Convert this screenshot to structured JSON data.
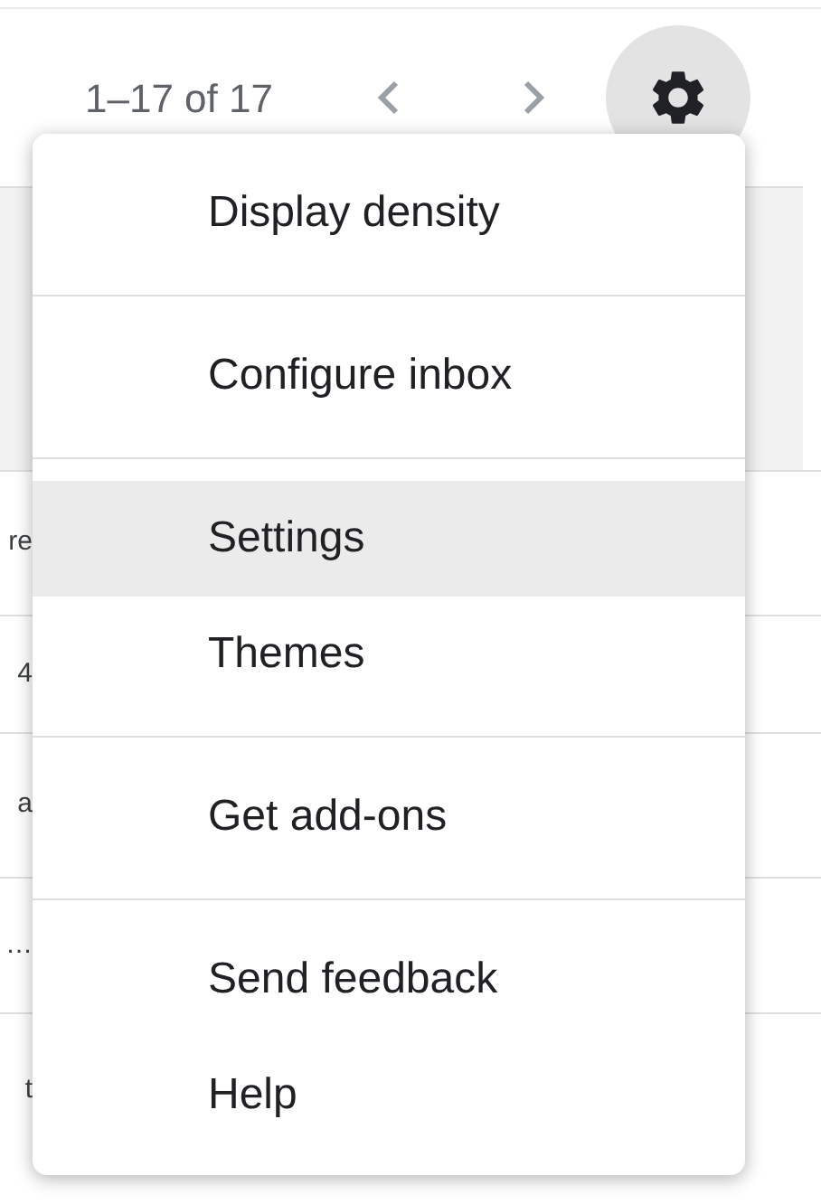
{
  "toolbar": {
    "page_range": "1–17 of 17"
  },
  "rows": [
    {
      "text": "re"
    },
    {
      "text": "4"
    },
    {
      "text": "a"
    },
    {
      "text": "…"
    },
    {
      "text": "t"
    }
  ],
  "menu": {
    "groups": [
      [
        {
          "label": "Display density",
          "selected": false
        }
      ],
      [
        {
          "label": "Configure inbox",
          "selected": false
        }
      ],
      [
        {
          "label": "Settings",
          "selected": true
        },
        {
          "label": "Themes",
          "selected": false
        }
      ],
      [
        {
          "label": "Get add-ons",
          "selected": false
        }
      ],
      [
        {
          "label": "Send feedback",
          "selected": false
        },
        {
          "label": "Help",
          "selected": false
        }
      ]
    ]
  }
}
